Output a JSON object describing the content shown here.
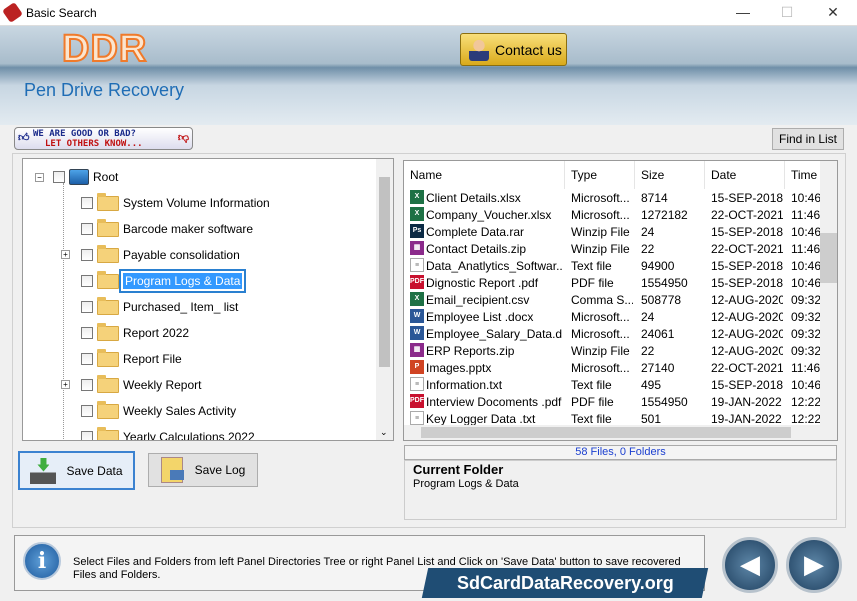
{
  "window": {
    "title": "Basic Search",
    "min": "—",
    "max": "☐",
    "close": "✕"
  },
  "header": {
    "logo": "DDR",
    "product": "Pen Drive Recovery",
    "contact_label": "Contact us"
  },
  "feedback": {
    "line1": "WE ARE GOOD OR BAD?",
    "line2": "LET OTHERS KNOW..."
  },
  "find_label": "Find in List",
  "tree": {
    "root": "Root",
    "items": [
      {
        "label": "System Volume Information",
        "expandable": false
      },
      {
        "label": "Barcode maker software",
        "expandable": false
      },
      {
        "label": "Payable consolidation",
        "expandable": true
      },
      {
        "label": "Program Logs & Data",
        "expandable": false,
        "selected": true
      },
      {
        "label": "Purchased_ Item_ list",
        "expandable": false
      },
      {
        "label": "Report 2022",
        "expandable": false
      },
      {
        "label": "Report File",
        "expandable": false
      },
      {
        "label": "Weekly Report",
        "expandable": true
      },
      {
        "label": "Weekly Sales Activity",
        "expandable": false
      },
      {
        "label": "Yearly Calculations 2022",
        "expandable": false
      }
    ]
  },
  "list": {
    "columns": [
      "Name",
      "Type",
      "Size",
      "Date",
      "Time"
    ],
    "rows": [
      {
        "icon": "excel",
        "name": "Client Details.xlsx",
        "type": "Microsoft...",
        "size": "8714",
        "date": "15-SEP-2018",
        "time": "10:46"
      },
      {
        "icon": "excel",
        "name": "Company_Voucher.xlsx",
        "type": "Microsoft...",
        "size": "1272182",
        "date": "22-OCT-2021",
        "time": "11:46"
      },
      {
        "icon": "photoshop",
        "name": "Complete Data.rar",
        "type": "Winzip File",
        "size": "24",
        "date": "15-SEP-2018",
        "time": "10:46"
      },
      {
        "icon": "winrar",
        "name": "Contact Details.zip",
        "type": "Winzip File",
        "size": "22",
        "date": "22-OCT-2021",
        "time": "11:46"
      },
      {
        "icon": "text",
        "name": "Data_Anatlytics_Softwar...",
        "type": "Text file",
        "size": "94900",
        "date": "15-SEP-2018",
        "time": "10:46"
      },
      {
        "icon": "pdf",
        "name": "Dignostic Report .pdf",
        "type": "PDF file",
        "size": "1554950",
        "date": "15-SEP-2018",
        "time": "10:46"
      },
      {
        "icon": "csv",
        "name": "Email_recipient.csv",
        "type": "Comma S...",
        "size": "508778",
        "date": "12-AUG-2020",
        "time": "09:32"
      },
      {
        "icon": "word",
        "name": "Employee List .docx",
        "type": "Microsoft...",
        "size": "24",
        "date": "12-AUG-2020",
        "time": "09:32"
      },
      {
        "icon": "word",
        "name": "Employee_Salary_Data.d...",
        "type": "Microsoft...",
        "size": "24061",
        "date": "12-AUG-2020",
        "time": "09:32"
      },
      {
        "icon": "winrar",
        "name": "ERP Reports.zip",
        "type": "Winzip File",
        "size": "22",
        "date": "12-AUG-2020",
        "time": "09:32"
      },
      {
        "icon": "powerpoint",
        "name": "Images.pptx",
        "type": "Microsoft...",
        "size": "27140",
        "date": "22-OCT-2021",
        "time": "11:46"
      },
      {
        "icon": "text",
        "name": "Information.txt",
        "type": "Text file",
        "size": "495",
        "date": "15-SEP-2018",
        "time": "10:46"
      },
      {
        "icon": "pdf",
        "name": "Interview Docoments .pdf",
        "type": "PDF file",
        "size": "1554950",
        "date": "19-JAN-2022",
        "time": "12:22"
      },
      {
        "icon": "text",
        "name": "Key Logger Data .txt",
        "type": "Text file",
        "size": "501",
        "date": "19-JAN-2022",
        "time": "12:22"
      }
    ]
  },
  "status": "58 Files, 0 Folders",
  "current_folder": {
    "label": "Current Folder",
    "value": "Program Logs & Data"
  },
  "buttons": {
    "save_data": "Save Data",
    "save_log": "Save Log"
  },
  "message": "Select Files and Folders from left Panel Directories Tree or right Panel List and Click on 'Save Data' button to save recovered Files and Folders.",
  "watermark": "SdCardDataRecovery.org"
}
